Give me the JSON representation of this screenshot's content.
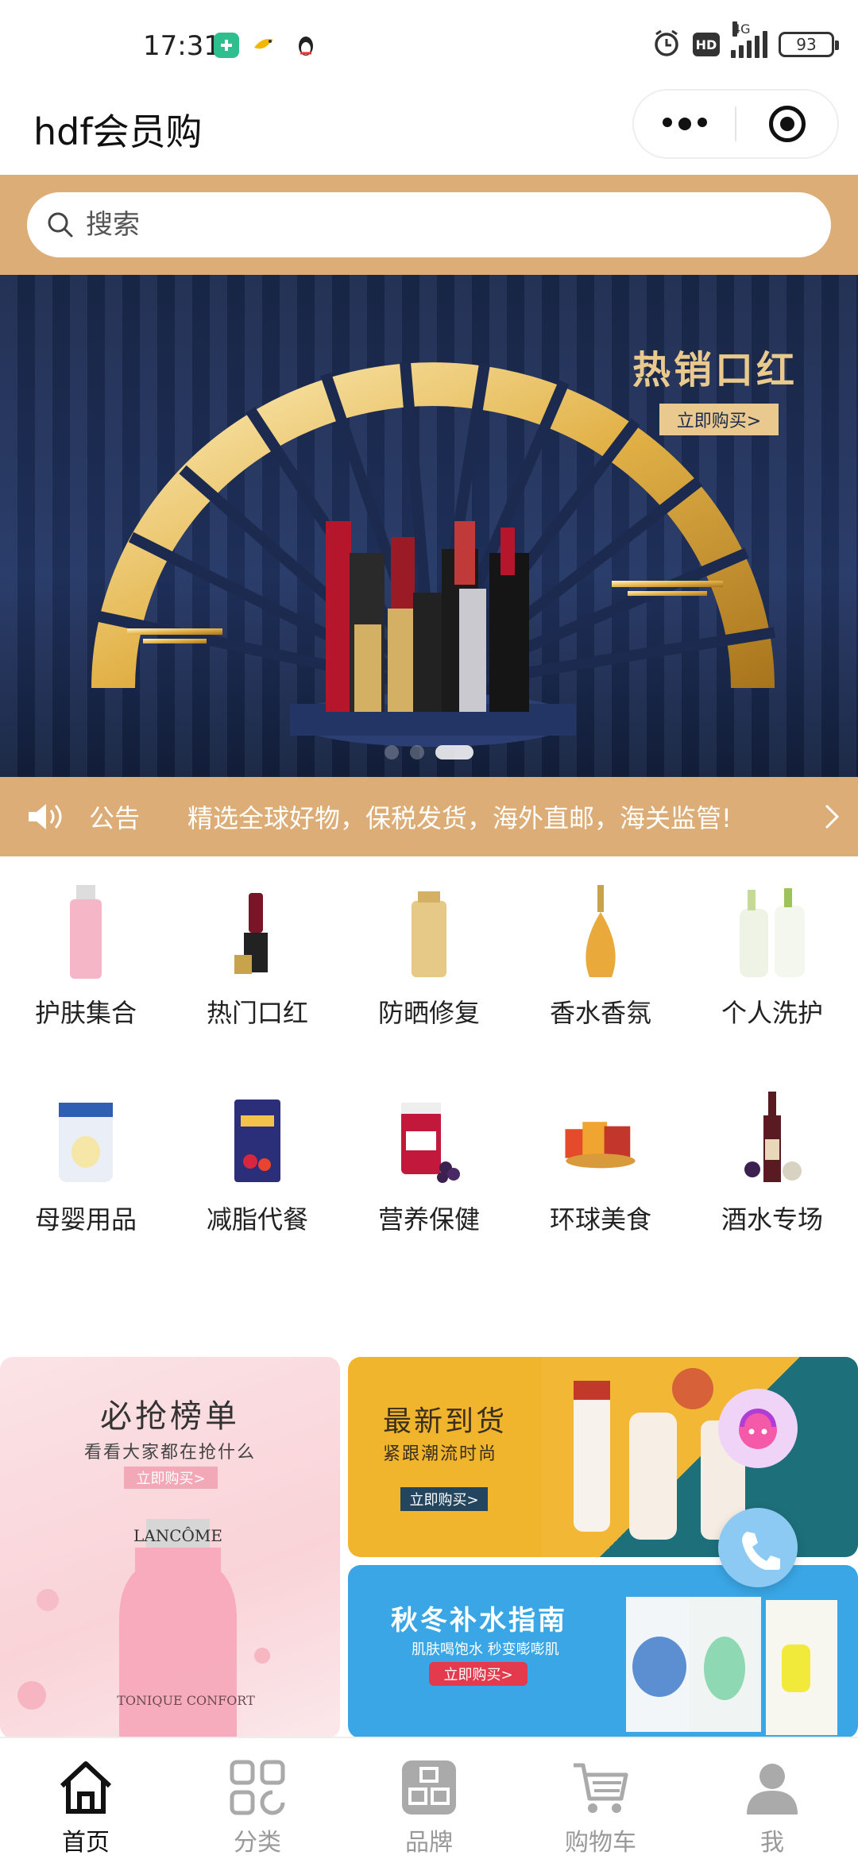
{
  "status_bar": {
    "time": "17:31",
    "network": "4G",
    "hd_badge": "HD",
    "battery": "93"
  },
  "nav": {
    "title": "hdf会员购"
  },
  "search": {
    "placeholder": "搜索"
  },
  "banner": {
    "title": "热销口红",
    "button": "立即购买>",
    "slide_count": 3,
    "active_slide": 3
  },
  "notice": {
    "label": "公告",
    "text": "精选全球好物，保税发货，海外直邮，海关监管!"
  },
  "categories": [
    {
      "label": "护肤集合",
      "icon": "toner-bottle-icon"
    },
    {
      "label": "热门口红",
      "icon": "lipstick-icon"
    },
    {
      "label": "防晒修复",
      "icon": "sunscreen-icon"
    },
    {
      "label": "香水香氛",
      "icon": "perfume-icon"
    },
    {
      "label": "个人洗护",
      "icon": "shampoo-icon"
    },
    {
      "label": "母婴用品",
      "icon": "milk-powder-icon"
    },
    {
      "label": "减脂代餐",
      "icon": "diet-pack-icon"
    },
    {
      "label": "营养保健",
      "icon": "supplement-icon"
    },
    {
      "label": "环球美食",
      "icon": "snacks-icon"
    },
    {
      "label": "酒水专场",
      "icon": "wine-icon"
    }
  ],
  "promos": {
    "rank": {
      "title": "必抢榜单",
      "subtitle": "看看大家都在抢什么",
      "button": "立即购买>",
      "product_brand": "LANCÔME",
      "product_name": "TONIQUE CONFORT"
    },
    "new_arrival": {
      "title": "最新到货",
      "subtitle": "紧跟潮流时尚",
      "button": "立即购买>"
    },
    "winter": {
      "title": "秋冬补水指南",
      "subtitle": "肌肤喝饱水 秒变嘭嘭肌",
      "button": "立即购买>"
    }
  },
  "tab_bar": {
    "items": [
      {
        "label": "首页",
        "icon": "home-icon",
        "active": true
      },
      {
        "label": "分类",
        "icon": "category-icon",
        "active": false
      },
      {
        "label": "品牌",
        "icon": "brand-icon",
        "active": false
      },
      {
        "label": "购物车",
        "icon": "cart-icon",
        "active": false
      },
      {
        "label": "我",
        "icon": "profile-icon",
        "active": false
      }
    ]
  },
  "colors": {
    "accent": "#dcad76",
    "banner_gold": "#e9c98e",
    "tab_active": "#111111",
    "tab_inactive": "#999999"
  }
}
